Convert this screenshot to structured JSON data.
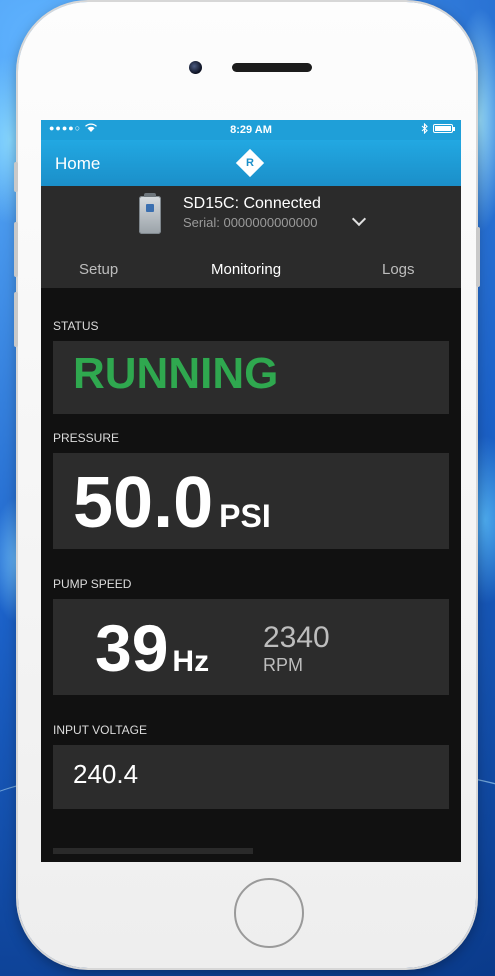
{
  "status_bar": {
    "time": "8:29 AM",
    "carrier_dots": "●●●●○"
  },
  "nav": {
    "back_label": "Home",
    "logo_letter": "R"
  },
  "device": {
    "name": "SD15C: Connected",
    "serial": "Serial: 0000000000000"
  },
  "tabs": [
    {
      "label": "Setup"
    },
    {
      "label": "Monitoring"
    },
    {
      "label": "Logs"
    }
  ],
  "status": {
    "label": "STATUS",
    "value": "RUNNING",
    "color": "#2fa84f"
  },
  "pressure": {
    "label": "PRESSURE",
    "value": "50.0",
    "unit": "PSI"
  },
  "pump_speed": {
    "label": "PUMP SPEED",
    "hz_value": "39",
    "hz_unit": "Hz",
    "rpm_value": "2340",
    "rpm_unit": "RPM"
  },
  "input_voltage": {
    "label": "INPUT VOLTAGE",
    "value": "240.4"
  },
  "colors": {
    "accent": "#1f9fd8",
    "panel": "#2c2c2c",
    "running": "#2fa84f"
  },
  "icons": [
    "wifi-icon",
    "bluetooth-icon",
    "battery-icon",
    "brand-logo-icon",
    "device-icon",
    "chevron-down-icon"
  ]
}
